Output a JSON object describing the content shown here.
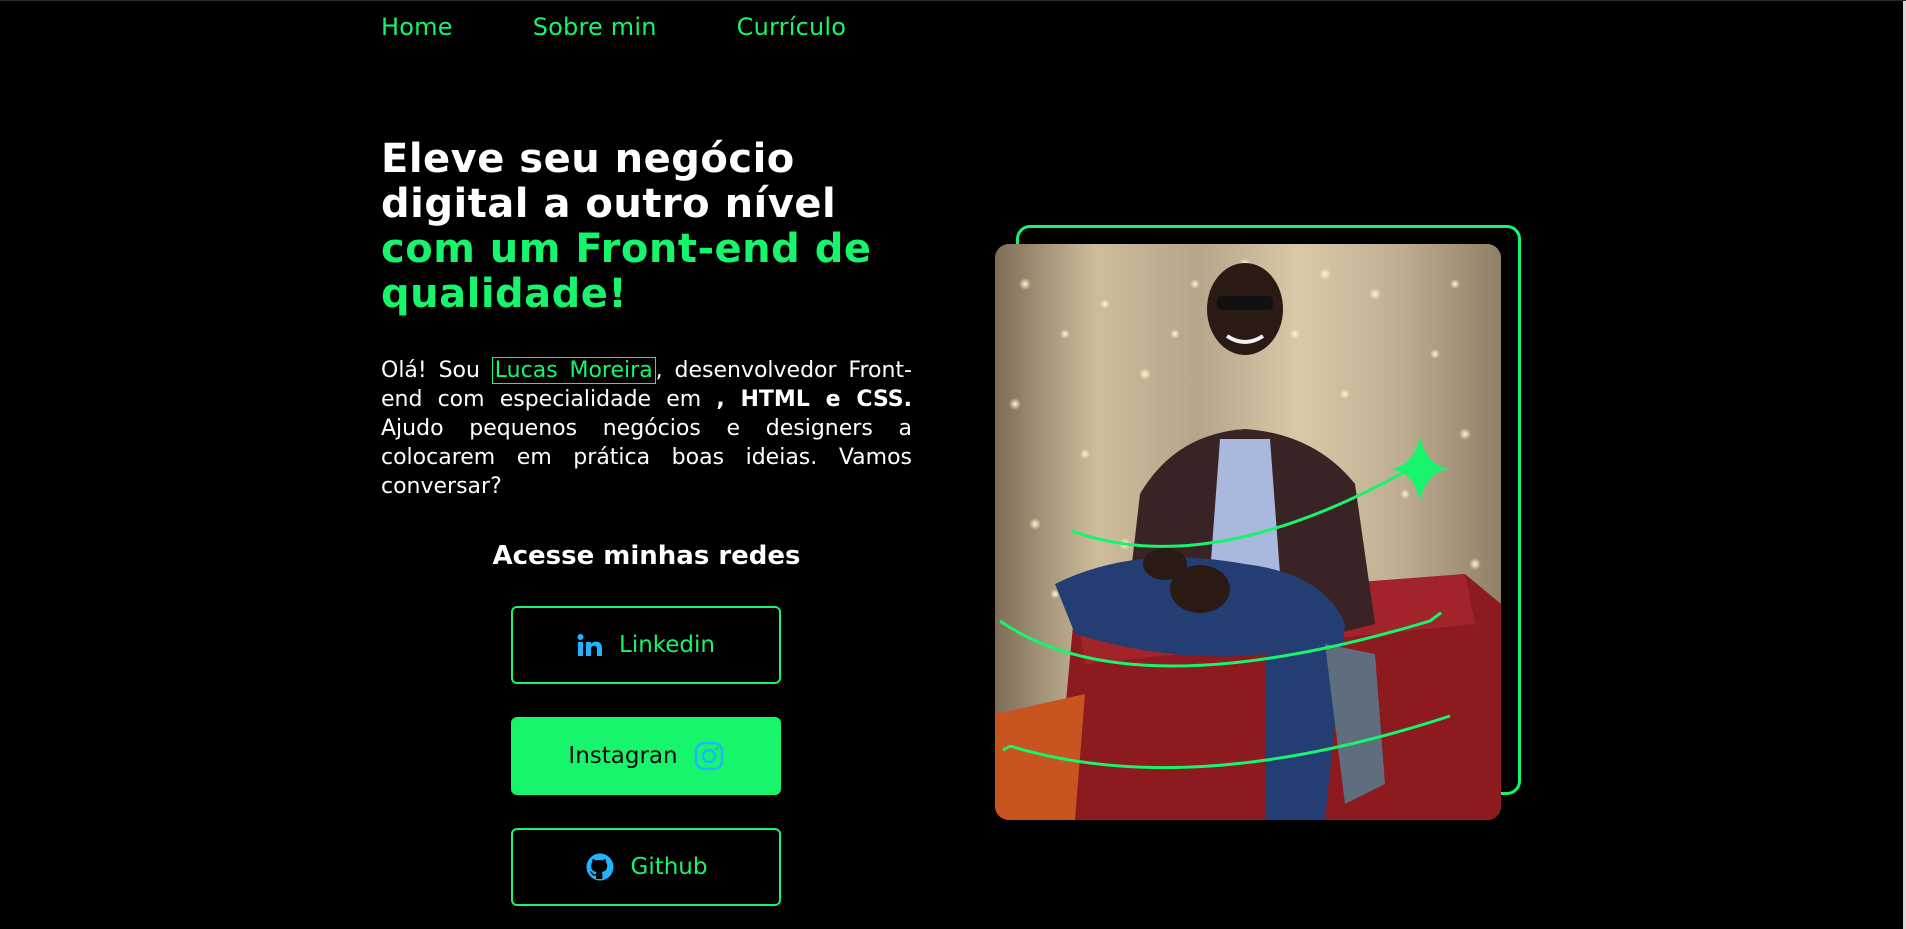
{
  "nav": {
    "items": [
      {
        "label": "Home"
      },
      {
        "label": "Sobre min"
      },
      {
        "label": "Currículo"
      }
    ]
  },
  "hero": {
    "headline_line1": "Eleve seu negócio",
    "headline_line2": "digital a outro nível",
    "headline_line3": "com um Front-end de",
    "headline_line4": "qualidade!",
    "intro_prefix": "Olá! Sou ",
    "intro_name": "Lucas Moreira",
    "intro_mid": ", desenvolvedor Front-end com especialidade em ",
    "intro_bold": ", HTML e CSS.",
    "intro_suffix": " Ajudo pequenos negócios e designers a colocarem em prática boas ideias. Vamos conversar?"
  },
  "social": {
    "title": "Acesse minhas redes",
    "buttons": [
      {
        "label": "Linkedin",
        "icon": "linkedin-icon"
      },
      {
        "label": "Instagran",
        "icon": "instagram-icon"
      },
      {
        "label": "Github",
        "icon": "github-icon"
      }
    ]
  },
  "photo": {
    "icon": "profile-photo"
  },
  "colors": {
    "background": "#000000",
    "accent": "#16f56b",
    "icon_blue": "#1fb6ff",
    "text": "#ffffff"
  }
}
